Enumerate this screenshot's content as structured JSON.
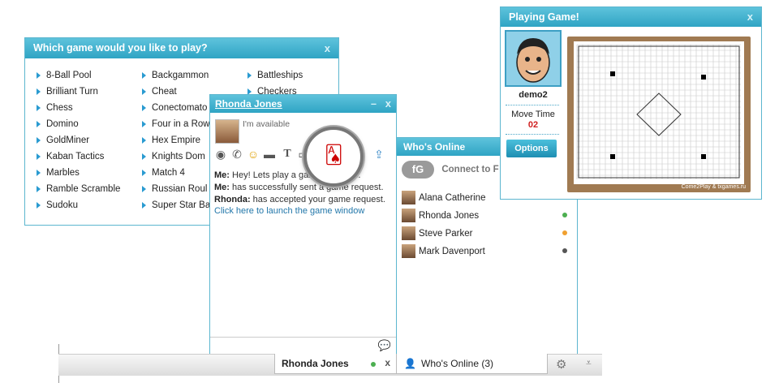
{
  "picker": {
    "title": "Which game would you like to play?",
    "close": "x",
    "col1": [
      "8-Ball Pool",
      "Brilliant Turn",
      "Chess",
      "Domino",
      "GoldMiner",
      "Kaban Tactics",
      "Marbles",
      "Ramble Scramble",
      "Sudoku"
    ],
    "col2": [
      "Backgammon",
      "Cheat",
      "Conectomato",
      "Four in a Row",
      "Hex Empire",
      "Knights Dom",
      "Match 4",
      "Russian Roul",
      "Super Star Ba"
    ],
    "col3": [
      "Battleships",
      "Checkers"
    ]
  },
  "chat": {
    "title": "Rhonda Jones",
    "min": "–",
    "close": "x",
    "status": "I'm available",
    "messages": [
      {
        "who": "Me:",
        "text": "Hey! Lets play a game together.."
      },
      {
        "who": "Me:",
        "text": "has successfully sent a game request."
      },
      {
        "who": "Rhonda:",
        "text": "has accepted your game request.",
        "link": "Click here to launch the game window"
      }
    ]
  },
  "online": {
    "title": "Who's Online",
    "fb_icon": "fG",
    "fb_text": "Connect to F",
    "contacts": [
      {
        "name": "Alana Catherine",
        "status": ""
      },
      {
        "name": "Rhonda Jones",
        "status": "#4caf50"
      },
      {
        "name": "Steve Parker",
        "status": "#f0a030"
      },
      {
        "name": "Mark Davenport",
        "status": "#555555"
      }
    ]
  },
  "playing": {
    "title": "Playing Game!",
    "close": "x",
    "player": "demo2",
    "move_time_label": "Move Time",
    "move_time_value": "02",
    "options_label": "Options",
    "credit": "Come2Play & txgames.ru"
  },
  "bottombar": {
    "tab1": "Rhonda Jones",
    "tab1_close": "x",
    "tab2": "Who's Online (3)"
  },
  "colors": {
    "accent": "#34a8c8",
    "link": "#2277aa",
    "move_time": "#d02020"
  }
}
